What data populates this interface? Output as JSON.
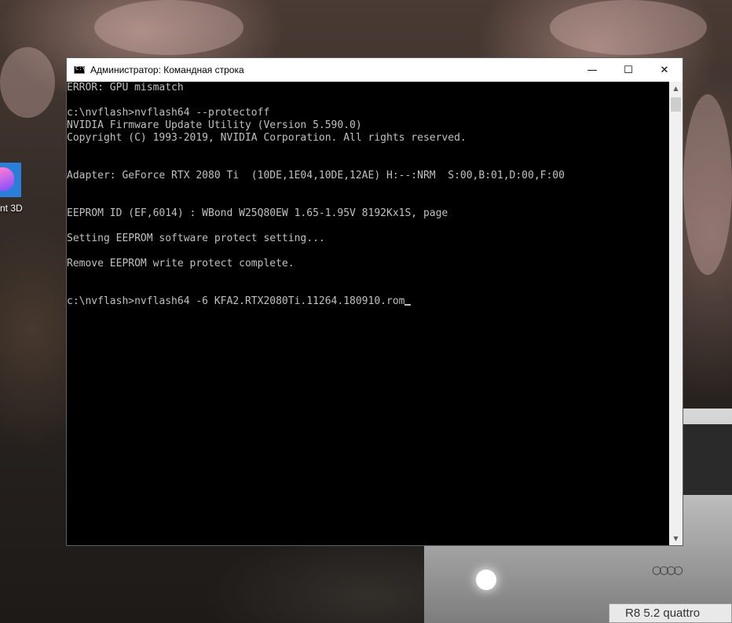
{
  "desktop": {
    "icon_label": "nt 3D",
    "car_plate": "R8 5.2 quattro",
    "car_logo": "○○○○"
  },
  "window": {
    "title": "Администратор: Командная строка",
    "icon": "cmd-icon",
    "icon_text": "C:\\",
    "controls": {
      "minimize": "—",
      "maximize": "☐",
      "close": "✕"
    }
  },
  "console": {
    "lines": [
      "ERROR: GPU mismatch",
      "",
      "c:\\nvflash>nvflash64 --protectoff",
      "NVIDIA Firmware Update Utility (Version 5.590.0)",
      "Copyright (C) 1993-2019, NVIDIA Corporation. All rights reserved.",
      "",
      "",
      "Adapter: GeForce RTX 2080 Ti  (10DE,1E04,10DE,12AE) H:--:NRM  S:00,B:01,D:00,F:00",
      "",
      "",
      "EEPROM ID (EF,6014) : WBond W25Q80EW 1.65-1.95V 8192Kx1S, page",
      "",
      "Setting EEPROM software protect setting...",
      "",
      "Remove EEPROM write protect complete.",
      "",
      "",
      "c:\\nvflash>nvflash64 -6 KFA2.RTX2080Ti.11264.180910.rom"
    ]
  },
  "scrollbar": {
    "up": "▲",
    "down": "▼"
  }
}
